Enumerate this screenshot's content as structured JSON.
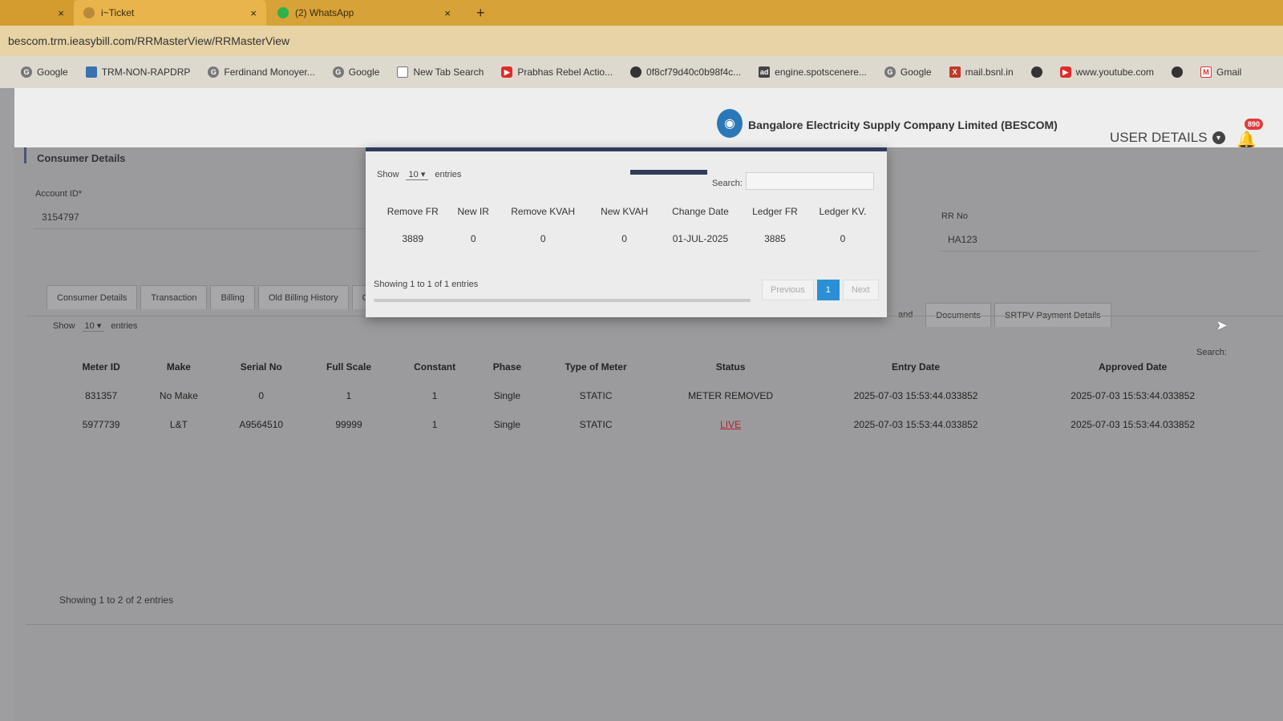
{
  "browser": {
    "tabs": [
      {
        "label": "",
        "close": "×"
      },
      {
        "label": "i~Ticket",
        "close": "×"
      },
      {
        "label": "(2) WhatsApp",
        "close": "×"
      }
    ],
    "new_tab": "+",
    "url": "bescom.trm.ieasybill.com/RRMasterView/RRMasterView",
    "bookmarks": [
      {
        "label": "Google",
        "icon": "google-icon"
      },
      {
        "label": "TRM-NON-RAPDRP",
        "icon": "site-icon"
      },
      {
        "label": "Ferdinand Monoyer...",
        "icon": "google-icon"
      },
      {
        "label": "Google",
        "icon": "google-icon"
      },
      {
        "label": "New Tab Search",
        "icon": "page-icon"
      },
      {
        "label": "Prabhas Rebel Actio...",
        "icon": "youtube-icon"
      },
      {
        "label": "0f8cf79d40c0b98f4c...",
        "icon": "globe-icon"
      },
      {
        "label": "engine.spotscenere...",
        "icon": "ad-icon"
      },
      {
        "label": "Google",
        "icon": "google-icon"
      },
      {
        "label": "mail.bsnl.in",
        "icon": "bsnl-icon"
      },
      {
        "label": "",
        "icon": "globe-icon"
      },
      {
        "label": "www.youtube.com",
        "icon": "youtube-icon"
      },
      {
        "label": "",
        "icon": "globe-icon"
      },
      {
        "label": "Gmail",
        "icon": "gmail-icon"
      }
    ]
  },
  "header": {
    "company": "Bangalore Electricity Supply Company Limited (BESCOM)",
    "user_details": "USER DETAILS",
    "notification_count": "890"
  },
  "consumer": {
    "section_title": "Consumer Details",
    "account_id_label": "Account ID*",
    "account_id_value": "3154797",
    "rr_no_label": "RR No",
    "rr_no_value": "HA123"
  },
  "tabs_left": [
    "Consumer Details",
    "Transaction",
    "Billing",
    "Old Billing History",
    "Co"
  ],
  "tabs_right": [
    "and",
    "Documents",
    "SRTPV Payment Details"
  ],
  "meter_table": {
    "show_label": "Show",
    "show_value": "10",
    "entries_label": "entries",
    "search_label": "Search:",
    "headers": [
      "Meter ID",
      "Make",
      "Serial No",
      "Full Scale",
      "Constant",
      "Phase",
      "Type of Meter",
      "Status",
      "Entry Date",
      "Approved Date"
    ],
    "rows": [
      [
        "831357",
        "No Make",
        "0",
        "1",
        "1",
        "Single",
        "STATIC",
        "METER REMOVED",
        "2025-07-03 15:53:44.033852",
        "2025-07-03 15:53:44.033852"
      ],
      [
        "5977739",
        "L&T",
        "A9564510",
        "99999",
        "1",
        "Single",
        "STATIC",
        "LIVE",
        "2025-07-03 15:53:44.033852",
        "2025-07-03 15:53:44.033852"
      ]
    ],
    "showing": "Showing 1 to 2 of 2 entries"
  },
  "modal": {
    "show_label": "Show",
    "show_value": "10",
    "entries_label": "entries",
    "search_label": "Search:",
    "headers": [
      "Remove FR",
      "New IR",
      "Remove KVAH",
      "New KVAH",
      "Change Date",
      "Ledger FR",
      "Ledger KV."
    ],
    "rows": [
      [
        "3889",
        "0",
        "0",
        "0",
        "01-JUL-2025",
        "3885",
        "0"
      ]
    ],
    "showing": "Showing 1 to 1 of 1 entries",
    "pager": {
      "previous": "Previous",
      "current": "1",
      "next": "Next"
    }
  }
}
